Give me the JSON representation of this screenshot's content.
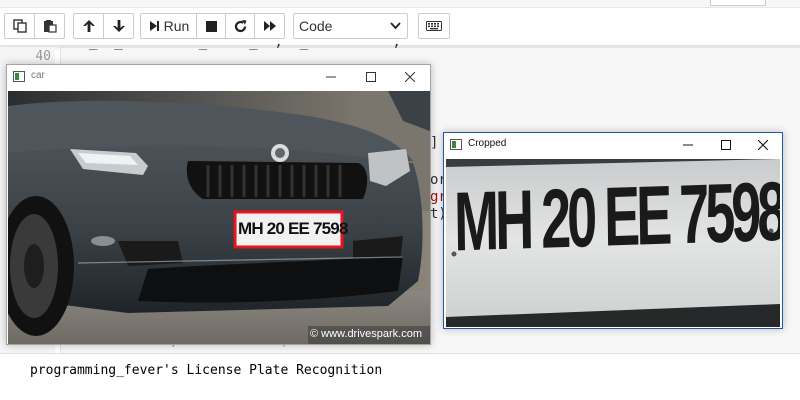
{
  "toolbar": {
    "buttons": [
      {
        "name": "copy-cells-icon"
      },
      {
        "name": "paste-cells-icon"
      },
      {
        "name": "move-up-icon"
      },
      {
        "name": "move-down-icon"
      },
      {
        "name": "run-icon",
        "label": "Run"
      },
      {
        "name": "stop-icon"
      },
      {
        "name": "restart-icon"
      },
      {
        "name": "restart-run-all-icon"
      },
      {
        "name": "keyboard-icon"
      }
    ],
    "run_label": "Run",
    "cell_type": "Code"
  },
  "cell": {
    "prompt_number": "40",
    "fragments": [
      "]",
      "or",
      "gr",
      "t)"
    ]
  },
  "output_text": "programming_fever's License Plate Recognition",
  "windows": {
    "car": {
      "title": "car",
      "plate_text": "MH 20 EE 7598",
      "watermark": "© www.drivespark.com",
      "highlight_color": "#e8141c"
    },
    "cropped": {
      "title": "Cropped",
      "plate_text": "MH 20 EE 7598",
      "border_color": "#1e5aa8"
    }
  }
}
